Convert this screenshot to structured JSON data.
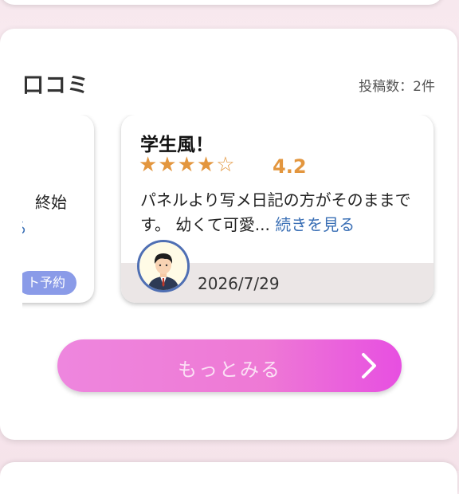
{
  "section": {
    "title": "口コミ",
    "post_count": "投稿数：2件"
  },
  "partial_card": {
    "text_fragment": "終始",
    "link_fragment": "る",
    "badge_label": "ト予約"
  },
  "review": {
    "title": "学生風！",
    "stars": "★★★★☆",
    "rating": "4.2",
    "body": "パネルより写メ日記の方がそのままです。 幼くて可愛...",
    "more_link": "続きを見る",
    "date": "2026/7/29"
  },
  "more_button": {
    "label": "もっとみる"
  },
  "colors": {
    "star": "#e3963e",
    "link": "#3a6fb5",
    "button_gradient_start": "#ee86de",
    "button_gradient_end": "#e74fe1",
    "badge": "#8a9be8"
  }
}
